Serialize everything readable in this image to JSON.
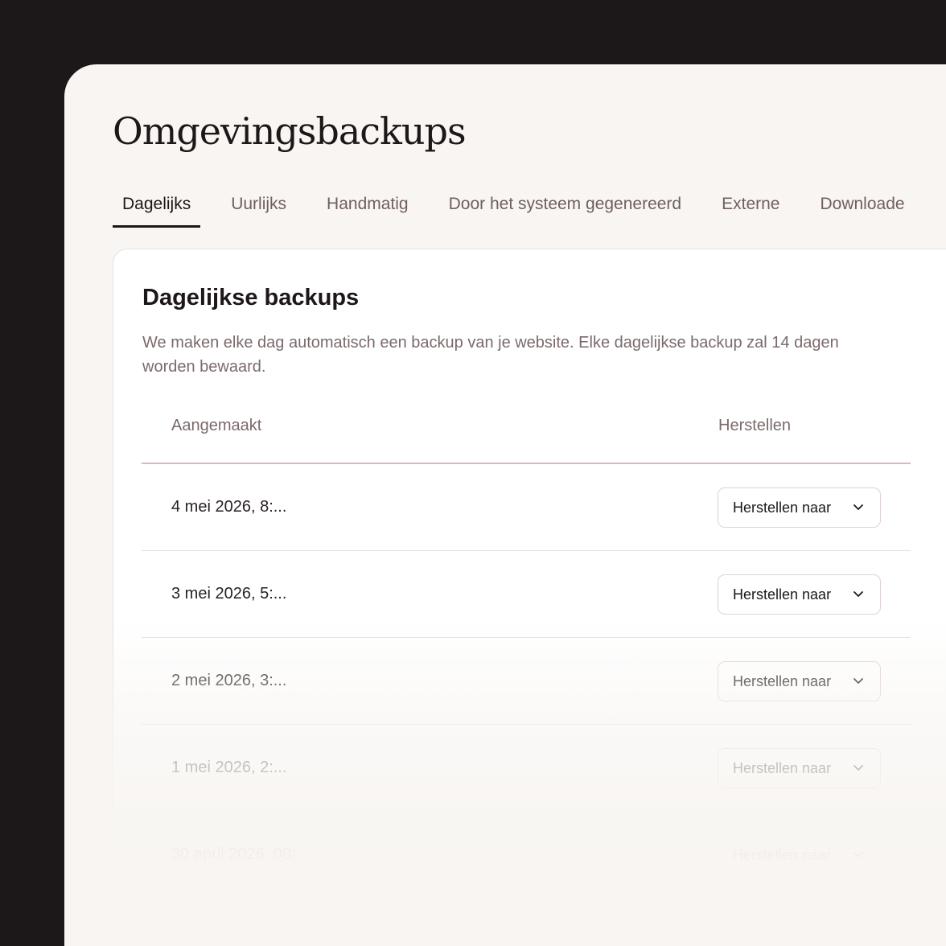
{
  "page": {
    "title": "Omgevingsbackups"
  },
  "tabs": [
    {
      "label": "Dagelijks",
      "active": true
    },
    {
      "label": "Uurlijks",
      "active": false
    },
    {
      "label": "Handmatig",
      "active": false
    },
    {
      "label": "Door het systeem gegenereerd",
      "active": false
    },
    {
      "label": "Externe",
      "active": false
    },
    {
      "label": "Downloade",
      "active": false
    }
  ],
  "card": {
    "title": "Dagelijkse backups",
    "description": "We maken elke dag automatisch een backup van je website. Elke dagelijkse backup zal 14 dagen worden bewaard."
  },
  "table": {
    "columns": {
      "created": "Aangemaakt",
      "restore": "Herstellen"
    },
    "rows": [
      {
        "created": "4 mei 2026, 8:...",
        "restore_label": "Herstellen naar"
      },
      {
        "created": "3 mei 2026, 5:...",
        "restore_label": "Herstellen naar"
      },
      {
        "created": "2 mei 2026, 3:...",
        "restore_label": "Herstellen naar"
      },
      {
        "created": "1 mei 2026, 2:...",
        "restore_label": "Herstellen naar"
      },
      {
        "created": "30 april 2026, 00:...",
        "restore_label": "Herstellen naar"
      }
    ]
  },
  "icons": {
    "dropdown": "chevron-down-icon"
  },
  "colors": {
    "outer_background": "#1c1718",
    "panel_background": "#f8f5f2",
    "text_primary": "#1d1718",
    "text_muted": "#7a6a6b",
    "header_divider": "#d4bcc0"
  }
}
